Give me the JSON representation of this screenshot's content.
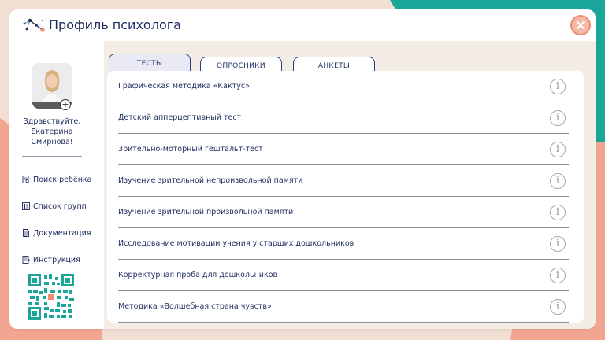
{
  "window": {
    "title": "Профиль психолога"
  },
  "sidebar": {
    "greeting": "Здравствуйте, Екатерина Смирнова!",
    "nav": [
      {
        "label": "Поиск ребёнка",
        "icon": "search-doc-icon"
      },
      {
        "label": "Список групп",
        "icon": "list-icon"
      },
      {
        "label": "Документация",
        "icon": "document-icon"
      },
      {
        "label": "Инструкция",
        "icon": "instruction-icon"
      }
    ]
  },
  "tabs": [
    {
      "label": "ТЕСТЫ",
      "active": true
    },
    {
      "label": "ОПРОСНИКИ",
      "active": false
    },
    {
      "label": "АНКЕТЫ",
      "active": false
    }
  ],
  "tests": [
    "Графическая методика «Кактус»",
    "Детский апперцептивный тест",
    "Зрительно-моторный гештальт-тест",
    "Изучение зрительной непроизвольной памяти",
    "Изучение зрительной произвольной памяти",
    "Исследование мотивации учения у старших дошкольников",
    "Корректурная проба для дошкольников",
    "Методика «Волшебная страна чувств»"
  ],
  "colors": {
    "accent": "#1e2b5f",
    "teal": "#1aa79a",
    "coral": "#f2a691",
    "close": "#ef8c74"
  }
}
